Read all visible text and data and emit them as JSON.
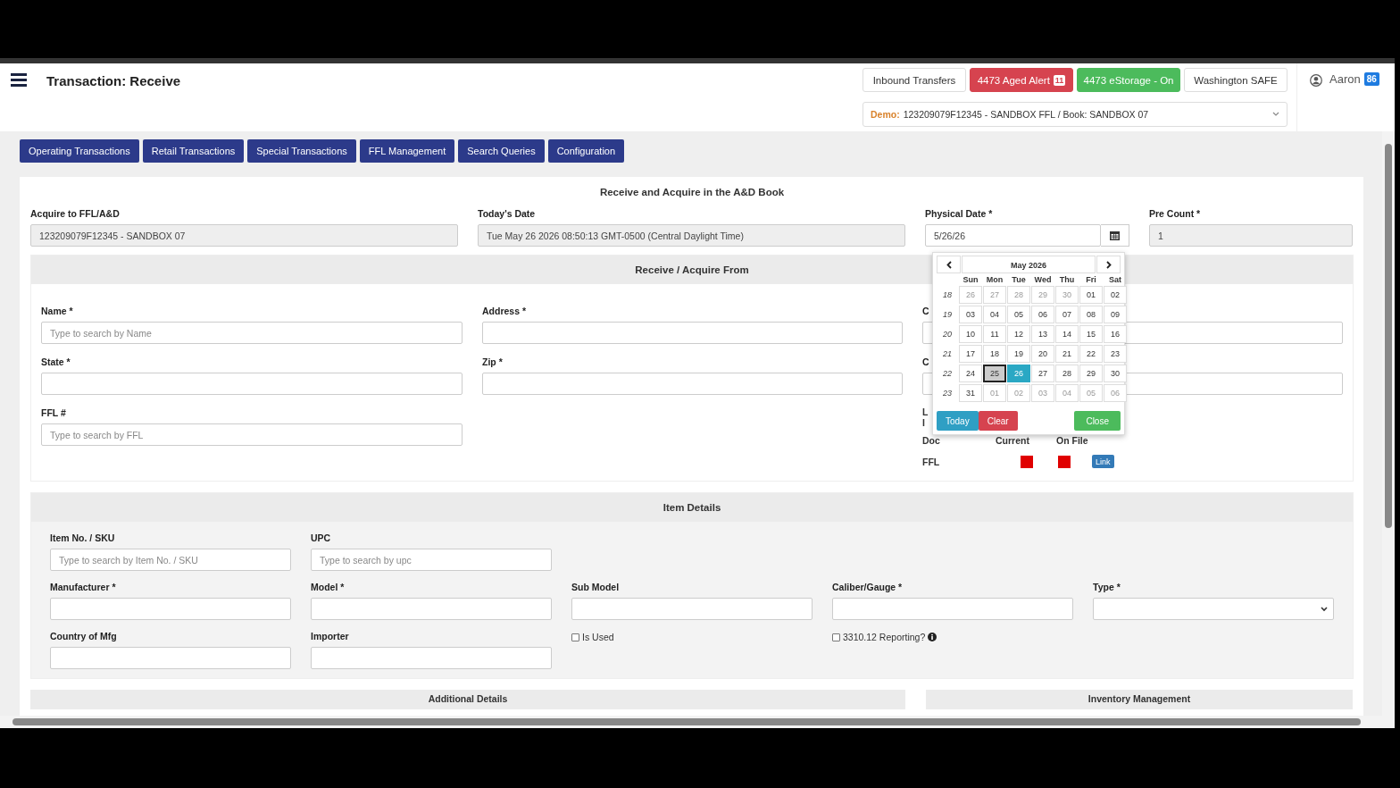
{
  "header": {
    "title": "Transaction: Receive",
    "buttons": [
      {
        "label": "Inbound Transfers",
        "kind": "plain"
      },
      {
        "label": "4473 Aged Alert",
        "kind": "danger",
        "badge": "11"
      },
      {
        "label": "4473 eStorage - On",
        "kind": "success"
      },
      {
        "label": "Washington SAFE",
        "kind": "plain"
      }
    ],
    "context": {
      "prefix": "Demo:",
      "value": "123209079F12345 - SANDBOX FFL / Book: SANDBOX 07"
    },
    "user": {
      "name": "Aaron",
      "badge": "86"
    }
  },
  "nav_tabs": [
    "Operating Transactions",
    "Retail Transactions",
    "Special Transactions",
    "FFL Management",
    "Search Queries",
    "Configuration"
  ],
  "form": {
    "title": "Receive and Acquire in the A&D Book",
    "fields": [
      {
        "label": "Acquire to FFL/A&D",
        "value": "123209079F12345 - SANDBOX 07",
        "readonly": true
      },
      {
        "label": "Today's Date",
        "value": "Tue May 26 2026 08:50:13 GMT-0500 (Central Daylight Time)",
        "readonly": true
      },
      {
        "label": "Physical Date *",
        "value": "5/26/26",
        "readonly": false
      },
      {
        "label": "Pre Count *",
        "value": "1",
        "readonly": true
      }
    ]
  },
  "receive_from": {
    "title": "Receive / Acquire From",
    "columns": [
      [
        {
          "label": "Name *",
          "placeholder": "Type to search by Name"
        },
        {
          "label": "State *"
        },
        {
          "label": "FFL #",
          "placeholder": "Type to search by FFL"
        }
      ],
      [
        {
          "label": "Address *"
        },
        {
          "label": "Zip *"
        }
      ],
      [
        {
          "label": "C"
        },
        {
          "label": "C"
        }
      ]
    ],
    "notes": [
      "L",
      "I"
    ],
    "docs": {
      "columns": [
        "Doc",
        "Current",
        "On File"
      ],
      "rows": [
        {
          "name": "FFL",
          "current": false,
          "on_file": false,
          "action": "Link"
        }
      ]
    }
  },
  "calendar": {
    "month": "May 2026",
    "weekdays": [
      "Sun",
      "Mon",
      "Tue",
      "Wed",
      "Thu",
      "Fri",
      "Sat"
    ],
    "weeks": [
      {
        "week": "18",
        "days": [
          {
            "d": "26",
            "muted": true,
            "selected": false,
            "hovered": false
          },
          {
            "d": "27",
            "muted": true,
            "selected": false,
            "hovered": false
          },
          {
            "d": "28",
            "muted": true,
            "selected": false,
            "hovered": false
          },
          {
            "d": "29",
            "muted": true,
            "selected": false,
            "hovered": false
          },
          {
            "d": "30",
            "muted": true,
            "selected": false,
            "hovered": false
          },
          {
            "d": "01",
            "muted": false,
            "selected": false,
            "hovered": false
          },
          {
            "d": "02",
            "muted": false,
            "selected": false,
            "hovered": false
          }
        ]
      },
      {
        "week": "19",
        "days": [
          {
            "d": "03",
            "muted": false,
            "selected": false,
            "hovered": false
          },
          {
            "d": "04",
            "muted": false,
            "selected": false,
            "hovered": false
          },
          {
            "d": "05",
            "muted": false,
            "selected": false,
            "hovered": false
          },
          {
            "d": "06",
            "muted": false,
            "selected": false,
            "hovered": false
          },
          {
            "d": "07",
            "muted": false,
            "selected": false,
            "hovered": false
          },
          {
            "d": "08",
            "muted": false,
            "selected": false,
            "hovered": false
          },
          {
            "d": "09",
            "muted": false,
            "selected": false,
            "hovered": false
          }
        ]
      },
      {
        "week": "20",
        "days": [
          {
            "d": "10",
            "muted": false,
            "selected": false,
            "hovered": false
          },
          {
            "d": "11",
            "muted": false,
            "selected": false,
            "hovered": false
          },
          {
            "d": "12",
            "muted": false,
            "selected": false,
            "hovered": false
          },
          {
            "d": "13",
            "muted": false,
            "selected": false,
            "hovered": false
          },
          {
            "d": "14",
            "muted": false,
            "selected": false,
            "hovered": false
          },
          {
            "d": "15",
            "muted": false,
            "selected": false,
            "hovered": false
          },
          {
            "d": "16",
            "muted": false,
            "selected": false,
            "hovered": false
          }
        ]
      },
      {
        "week": "21",
        "days": [
          {
            "d": "17",
            "muted": false,
            "selected": false,
            "hovered": false
          },
          {
            "d": "18",
            "muted": false,
            "selected": false,
            "hovered": false
          },
          {
            "d": "19",
            "muted": false,
            "selected": false,
            "hovered": false
          },
          {
            "d": "20",
            "muted": false,
            "selected": false,
            "hovered": false
          },
          {
            "d": "21",
            "muted": false,
            "selected": false,
            "hovered": false
          },
          {
            "d": "22",
            "muted": false,
            "selected": false,
            "hovered": false
          },
          {
            "d": "23",
            "muted": false,
            "selected": false,
            "hovered": false
          }
        ]
      },
      {
        "week": "22",
        "days": [
          {
            "d": "24",
            "muted": false,
            "selected": false,
            "hovered": false
          },
          {
            "d": "25",
            "muted": false,
            "selected": false,
            "hovered": true
          },
          {
            "d": "26",
            "muted": false,
            "selected": true,
            "hovered": false
          },
          {
            "d": "27",
            "muted": false,
            "selected": false,
            "hovered": false
          },
          {
            "d": "28",
            "muted": false,
            "selected": false,
            "hovered": false
          },
          {
            "d": "29",
            "muted": false,
            "selected": false,
            "hovered": false
          },
          {
            "d": "30",
            "muted": false,
            "selected": false,
            "hovered": false
          }
        ]
      },
      {
        "week": "23",
        "days": [
          {
            "d": "31",
            "muted": false,
            "selected": false,
            "hovered": false
          },
          {
            "d": "01",
            "muted": true,
            "selected": false,
            "hovered": false
          },
          {
            "d": "02",
            "muted": true,
            "selected": false,
            "hovered": false
          },
          {
            "d": "03",
            "muted": true,
            "selected": false,
            "hovered": false
          },
          {
            "d": "04",
            "muted": true,
            "selected": false,
            "hovered": false
          },
          {
            "d": "05",
            "muted": true,
            "selected": false,
            "hovered": false
          },
          {
            "d": "06",
            "muted": true,
            "selected": false,
            "hovered": false
          }
        ]
      }
    ],
    "buttons": [
      {
        "label": "Today",
        "kind": "info"
      },
      {
        "label": "Clear",
        "kind": "danger"
      },
      {
        "label": "Close",
        "kind": "success"
      }
    ]
  },
  "item_details": {
    "title": "Item Details",
    "rows": [
      [
        {
          "label": "Item No. / SKU",
          "kind": "text",
          "placeholder": "Type to search by Item No. / SKU"
        },
        {
          "label": "UPC",
          "kind": "text",
          "placeholder": "Type to search by upc"
        }
      ],
      [
        {
          "label": "Manufacturer *",
          "kind": "text"
        },
        {
          "label": "Model *",
          "kind": "text"
        },
        {
          "label": "Sub Model",
          "kind": "text"
        },
        {
          "label": "Caliber/Gauge *",
          "kind": "text"
        },
        {
          "label": "Type *",
          "kind": "select"
        }
      ],
      [
        {
          "label": "Country of Mfg",
          "kind": "text"
        },
        {
          "label": "Importer",
          "kind": "text"
        },
        {
          "label": "Is Used",
          "kind": "checkbox",
          "checked": false,
          "info": false
        },
        {
          "label": "3310.12 Reporting?",
          "kind": "checkbox",
          "checked": false,
          "info": true
        }
      ]
    ]
  },
  "lower_sections": [
    "Additional Details",
    "Inventory Management"
  ]
}
